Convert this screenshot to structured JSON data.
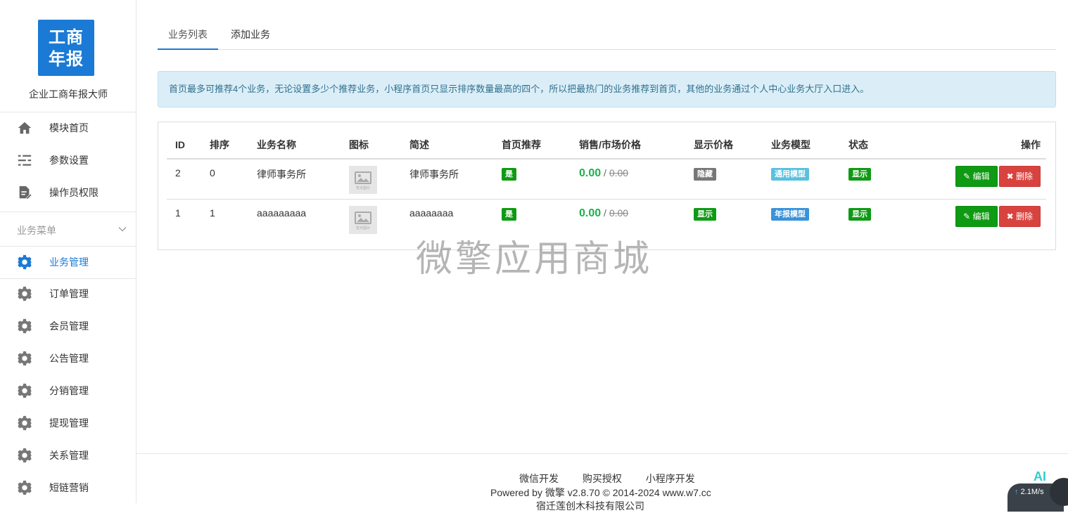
{
  "app": {
    "logo_line1": "工商",
    "logo_line2": "年报",
    "name": "企业工商年报大师"
  },
  "sidebar": {
    "top_items": [
      {
        "label": "模块首页",
        "icon": "home-icon"
      },
      {
        "label": "参数设置",
        "icon": "list-settings-icon"
      },
      {
        "label": "操作员权限",
        "icon": "document-edit-icon"
      }
    ],
    "section_label": "业务菜单",
    "menu_items": [
      {
        "label": "业务管理",
        "icon": "gear-icon",
        "active": true
      },
      {
        "label": "订单管理",
        "icon": "gear-icon"
      },
      {
        "label": "会员管理",
        "icon": "gear-icon"
      },
      {
        "label": "公告管理",
        "icon": "gear-icon"
      },
      {
        "label": "分销管理",
        "icon": "gear-icon"
      },
      {
        "label": "提现管理",
        "icon": "gear-icon"
      },
      {
        "label": "关系管理",
        "icon": "gear-icon"
      },
      {
        "label": "短链营销",
        "icon": "gear-icon"
      }
    ]
  },
  "tabs": [
    {
      "label": "业务列表",
      "active": true
    },
    {
      "label": "添加业务",
      "active": false
    }
  ],
  "alert_text": "首页最多可推荐4个业务，无论设置多少个推荐业务，小程序首页只显示排序数量最高的四个，所以把最热门的业务推荐到首页，其他的业务通过个人中心业务大厅入口进入。",
  "table": {
    "headers": [
      "ID",
      "排序",
      "业务名称",
      "图标",
      "简述",
      "首页推荐",
      "销售/市场价格",
      "显示价格",
      "业务模型",
      "状态",
      "操作"
    ],
    "rows": [
      {
        "id": "2",
        "sort": "0",
        "name": "律师事务所",
        "icon_caption": "暂无图片",
        "desc": "律师事务所",
        "recommend": "是",
        "price": "0.00",
        "sep": "/",
        "market_price": "0.00",
        "show_price": "隐藏",
        "model": "通用模型",
        "status": "显示",
        "edit": "编辑",
        "delete": "删除"
      },
      {
        "id": "1",
        "sort": "1",
        "name": "aaaaaaaaa",
        "icon_caption": "暂无图片",
        "desc": "aaaaaaaa",
        "recommend": "是",
        "price": "0.00",
        "sep": "/",
        "market_price": "0.00",
        "show_price": "显示",
        "model": "年报模型",
        "status": "显示",
        "edit": "编辑",
        "delete": "删除"
      }
    ]
  },
  "watermark": "微擎应用商城",
  "footer": {
    "links": [
      "微信开发",
      "购买授权",
      "小程序开发"
    ],
    "powered": "Powered by 微擎 v2.8.70 © 2014-2024 www.w7.cc",
    "company_cut": "宿迁莲创木科技有限公司"
  },
  "overlay": {
    "ai": "AI",
    "speed": "2.1M/s"
  },
  "colors": {
    "primary": "#1a7ad6",
    "success": "#0f9a13",
    "danger": "#d9433f",
    "info_bg": "#dbeef7",
    "price_green": "#1bb24a"
  }
}
